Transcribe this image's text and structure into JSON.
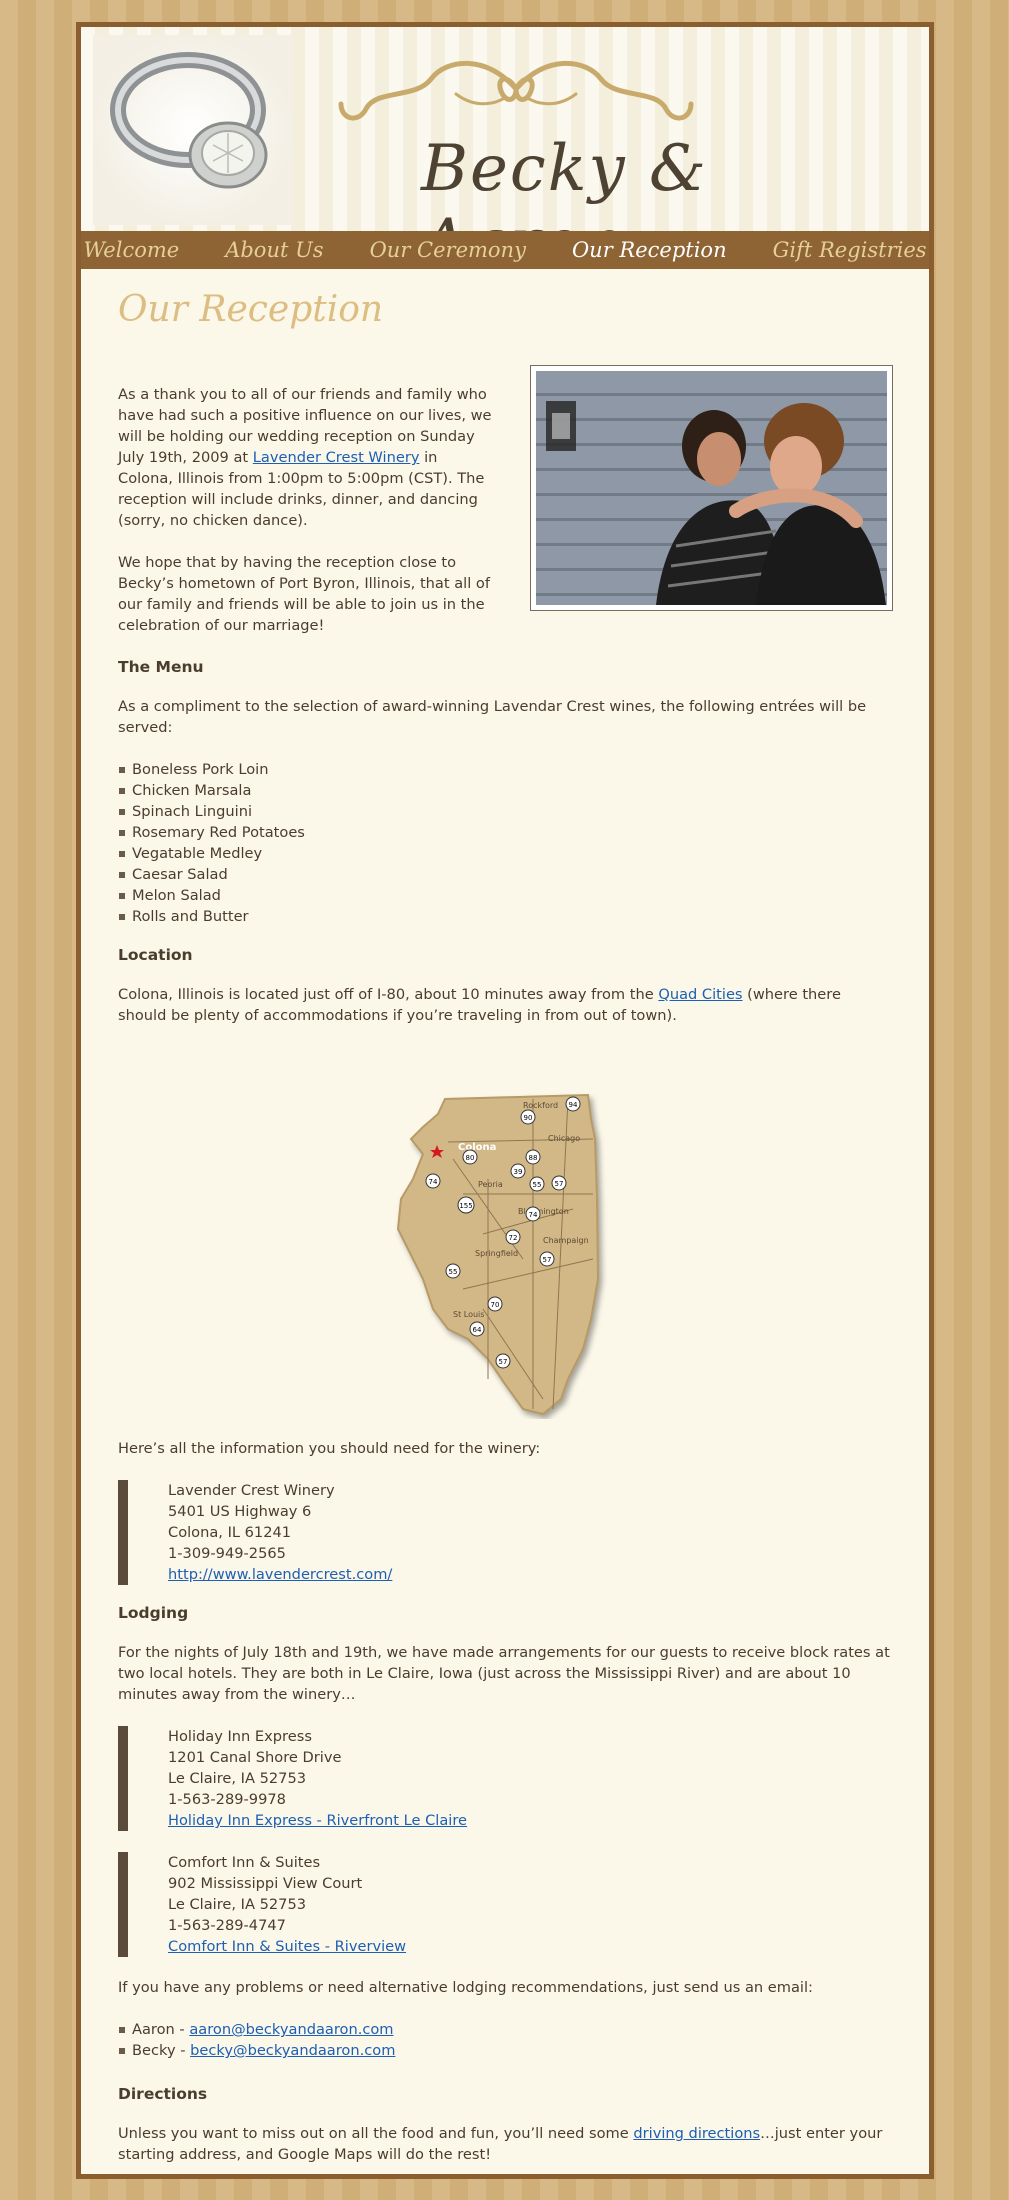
{
  "header": {
    "names": "Becky & Aaron"
  },
  "nav": [
    {
      "label": "Welcome",
      "active": false
    },
    {
      "label": "About Us",
      "active": false
    },
    {
      "label": "Our Ceremony",
      "active": false
    },
    {
      "label": "Our Reception",
      "active": true
    },
    {
      "label": "Gift Registries",
      "active": false
    }
  ],
  "page_title": "Our Reception",
  "intro": {
    "p1_a": "As a thank you to all of our friends and family who have had such a positive influence on our lives, we will be holding our wedding reception on Sunday July 19th, 2009 at ",
    "p1_link": "Lavender Crest Winery",
    "p1_b": " in Colona, Illinois from 1:00pm to 5:00pm (CST). The reception will include drinks, dinner, and dancing (sorry, no chicken dance).",
    "p2": "We hope that by having the reception close to Becky’s hometown of Port Byron, Illinois, that all of our family and friends will be able to join us in the celebration of our marriage!"
  },
  "menu": {
    "heading": "The Menu",
    "intro": "As a compliment to the selection of award-winning Lavendar Crest wines, the following entrées will be served:",
    "items": [
      "Boneless Pork Loin",
      "Chicken Marsala",
      "Spinach Linguini",
      "Rosemary Red Potatoes",
      "Vegatable Medley",
      "Caesar Salad",
      "Melon Salad",
      "Rolls and Butter"
    ]
  },
  "location": {
    "heading": "Location",
    "text_a": "Colona, Illinois is located just off of I-80, about 10 minutes away from the ",
    "link": "Quad Cities",
    "text_b": " (where there should be plenty of accommodations if you’re traveling in from out of town).",
    "map": {
      "cities": [
        "Rockford",
        "Chicago",
        "Colona",
        "Peoria",
        "Bloomington",
        "Champaign",
        "Springfield",
        "St Louis"
      ],
      "highways": [
        "94",
        "90",
        "88",
        "80",
        "39",
        "55",
        "57",
        "74",
        "155",
        "74",
        "72",
        "57",
        "55",
        "70",
        "64",
        "57"
      ]
    }
  },
  "winery": {
    "intro": "Here’s all the information you should need for the winery:",
    "name": "Lavender Crest Winery",
    "street": "5401 US Highway 6",
    "city": "Colona, IL  61241",
    "phone": "1-309-949-2565",
    "url": "http://www.lavendercrest.com/"
  },
  "lodging": {
    "heading": "Lodging",
    "intro": "For the nights of July 18th and 19th, we have made arrangements for our guests to receive block rates at two local hotels. They are both in Le Claire, Iowa (just across the Mississippi River) and are about 10 minutes away from the winery…",
    "hotels": [
      {
        "name": "Holiday Inn Express",
        "street": "1201 Canal Shore Drive",
        "city": "Le Claire, IA  52753",
        "phone": "1-563-289-9978",
        "link": "Holiday Inn Express - Riverfront Le Claire"
      },
      {
        "name": "Comfort Inn & Suites",
        "street": "902 Mississippi View Court",
        "city": "Le Claire, IA  52753",
        "phone": "1-563-289-4747",
        "link": "Comfort Inn & Suites - Riverview"
      }
    ],
    "contact_intro": "If you have any problems or need alternative lodging recommendations, just send us an email:",
    "contacts": [
      {
        "name": "Aaron - ",
        "email": "aaron@beckyandaaron.com"
      },
      {
        "name": "Becky - ",
        "email": "becky@beckyandaaron.com"
      }
    ]
  },
  "directions": {
    "heading": "Directions",
    "text_a": "Unless you want to miss out on all the food and fun, you’ll need some ",
    "link": "driving directions",
    "text_b": "…just enter your starting address, and Google Maps will do the rest!"
  }
}
